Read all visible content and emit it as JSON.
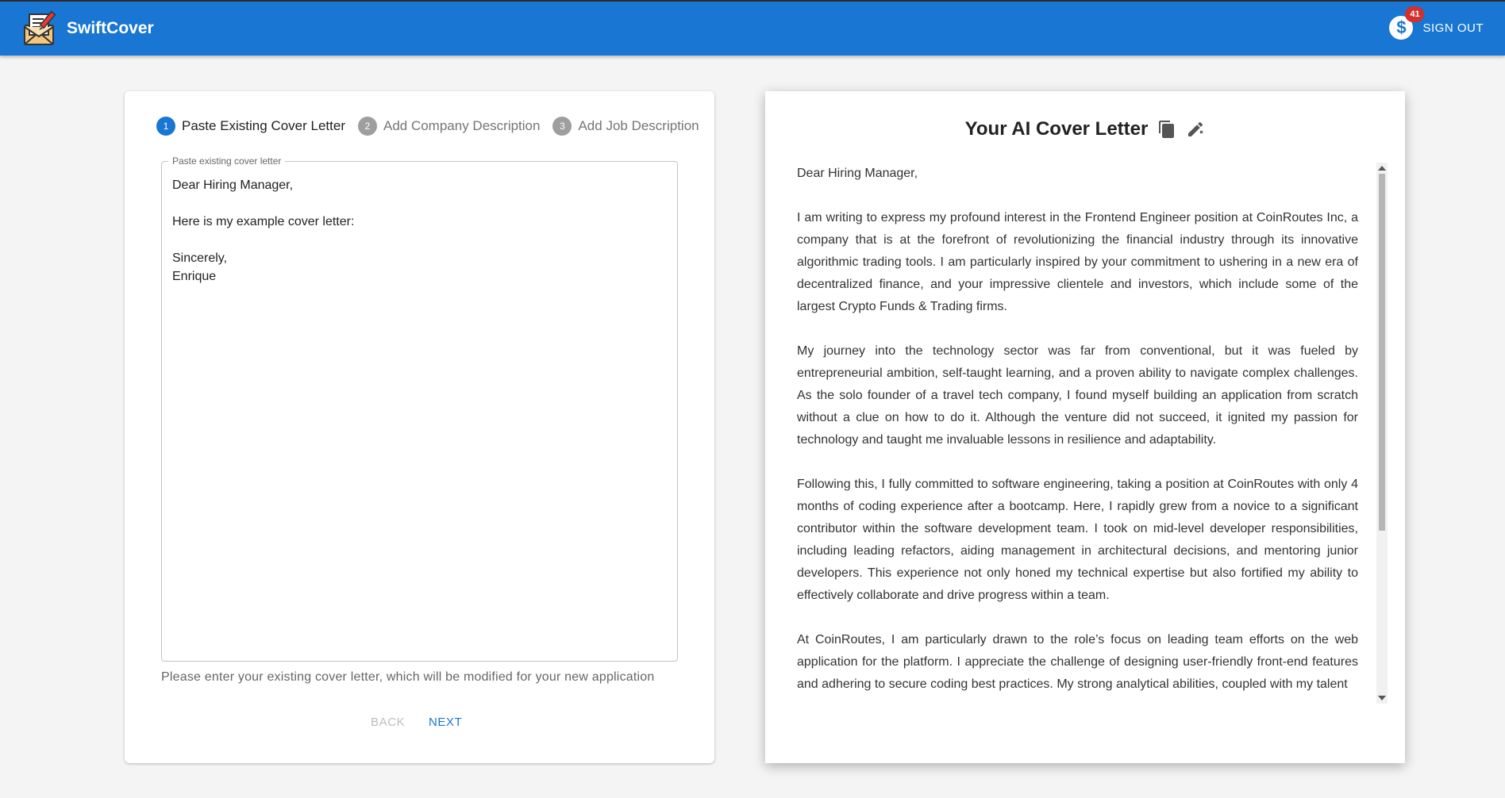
{
  "app": {
    "name": "SwiftCover",
    "credits_icon": "dollar-coin-icon",
    "credits_badge": "41",
    "sign_out_label": "SIGN OUT",
    "colors": {
      "primary": "#1976d2",
      "badge": "#d32f2f",
      "background": "#f4f4f4"
    }
  },
  "stepper": {
    "steps": [
      {
        "number": "1",
        "label": "Paste Existing Cover Letter",
        "active": true
      },
      {
        "number": "2",
        "label": "Add Company Description",
        "active": false
      },
      {
        "number": "3",
        "label": "Add Job Description",
        "active": false
      }
    ]
  },
  "form": {
    "legend": "Paste existing cover letter",
    "value": "Dear Hiring Manager,\n\nHere is my example cover letter:\n\nSincerely,\nEnrique",
    "helper": "Please enter your existing cover letter, which will be modified for your new application",
    "back_label": "BACK",
    "next_label": "NEXT"
  },
  "result": {
    "title": "Your AI Cover Letter",
    "copy_icon": "copy-icon",
    "edit_icon": "edit-pencil-icon",
    "paragraphs": [
      "Dear Hiring Manager,",
      "I am writing to express my profound interest in the Frontend Engineer position at CoinRoutes Inc, a company that is at the forefront of revolutionizing the financial industry through its innovative algorithmic trading tools. I am particularly inspired by your commitment to ushering in a new era of decentralized finance, and your impressive clientele and investors, which include some of the largest Crypto Funds & Trading firms.",
      "My journey into the technology sector was far from conventional, but it was fueled by entrepreneurial ambition, self-taught learning, and a proven ability to navigate complex challenges. As the solo founder of a travel tech company, I found myself building an application from scratch without a clue on how to do it. Although the venture did not succeed, it ignited my passion for technology and taught me invaluable lessons in resilience and adaptability.",
      "Following this, I fully committed to software engineering, taking a position at CoinRoutes with only 4 months of coding experience after a bootcamp. Here, I rapidly grew from a novice to a significant contributor within the software development team. I took on mid-level developer responsibilities, including leading refactors, aiding management in architectural decisions, and mentoring junior developers. This experience not only honed my technical expertise but also fortified my ability to effectively collaborate and drive progress within a team.",
      "At CoinRoutes, I am particularly drawn to the role’s focus on leading team efforts on the web application for the platform. I appreciate the challenge of designing user-friendly front-end features and adhering to secure coding best practices. My strong analytical abilities, coupled with my talent"
    ]
  }
}
